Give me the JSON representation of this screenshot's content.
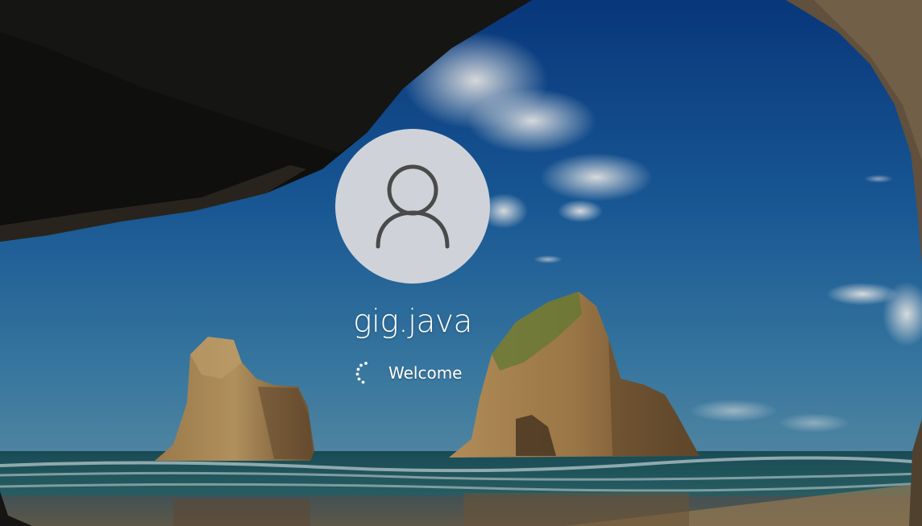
{
  "login": {
    "username": "gig.java",
    "status": "Welcome"
  },
  "icons": {
    "avatar": "user-icon",
    "spinner": "loading-spinner-icon"
  },
  "colors": {
    "avatar_bg": "#cfd3d9",
    "avatar_glyph": "#4a4a4a",
    "text": "#ffffff"
  }
}
